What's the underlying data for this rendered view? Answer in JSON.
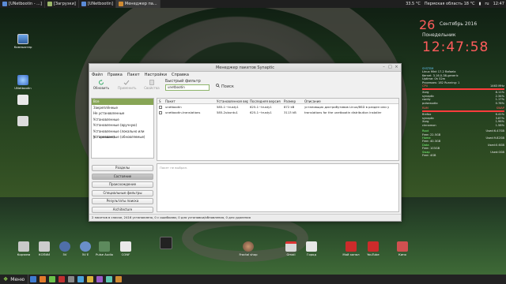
{
  "top_panel": {
    "tasks": [
      {
        "label": "[UNetbootin - ...]",
        "color": "#5b8bd6",
        "active": false
      },
      {
        "label": "[Загрузки]",
        "color": "#9cb86a",
        "active": false
      },
      {
        "label": "[UNetbootin]",
        "color": "#5b8bd6",
        "active": false
      },
      {
        "label": "Менеджер па...",
        "color": "#cf8b32",
        "active": true
      }
    ],
    "tray": {
      "temp": "33.5 °C",
      "weather": "Пермская область 18 °C",
      "battery": "▮",
      "lang": "ru",
      "time": "12:47"
    }
  },
  "clock": {
    "day": "26",
    "date": "Сентябрь 2016",
    "weekday": "Понедельник",
    "time": "12:47:58"
  },
  "conky": {
    "system_label": "SYSTEM",
    "lines": [
      "Linux Mint 17.2 Rafaela",
      "Kernel: 3.16.0-38-generic",
      "Uptime: 0h 52m",
      "Processes: 182  Running: 1"
    ],
    "cpu_label": "CPU",
    "cpu_freq": "1463 MHz",
    "ram_label": "RAM",
    "swap_label": "SWAP",
    "top_procs": [
      {
        "name": "Xorg",
        "val": "8.11%"
      },
      {
        "name": "synaptic",
        "val": "2.34%"
      },
      {
        "name": "conky",
        "val": "1.17%"
      },
      {
        "name": "pulseaudio",
        "val": "0.78%"
      }
    ],
    "mem_procs": [
      {
        "name": "firefox",
        "val": "6.41%"
      },
      {
        "name": "synaptic",
        "val": "3.87%"
      },
      {
        "name": "Xorg",
        "val": "1.96%"
      },
      {
        "name": "cinnamon",
        "val": "1.58%"
      }
    ],
    "disks": [
      {
        "name": "Root",
        "used": "Used:6.47GB",
        "free": "Free: 22.5GB"
      },
      {
        "name": "Home",
        "used": "Used:9.82GB",
        "free": "Free: 40.3GB"
      },
      {
        "name": "Data",
        "used": "Used:0.6GB",
        "free": "Free: 103GB"
      },
      {
        "name": "Swap",
        "used": "Used:0GB",
        "free": "Free: 4GB"
      }
    ]
  },
  "desktop_icons": {
    "computer": "Компьютер",
    "unetbootin": "UNetbootin",
    "file": "",
    "book": ""
  },
  "window": {
    "title": "Менеджер пакетов Synaptic",
    "menu": [
      "Файл",
      "Правка",
      "Пакет",
      "Настройки",
      "Справка"
    ],
    "toolbar": {
      "reload": "Обновить",
      "apply": "Применить",
      "properties": "Свойства"
    },
    "filter_label": "Быстрый фильтр",
    "filter_value": "unetbootin",
    "search_label": "Поиск",
    "categories": [
      "Все",
      "Закреплённые",
      "Не установленные",
      "Установленные",
      "Установленные (вручную)",
      "Установленные (локально или устаревшие)",
      "Установленные (обновляемые)"
    ],
    "filter_buttons": [
      "Разделы",
      "Состояние",
      "Происхождение",
      "Специальные фильтры",
      "Результаты поиска",
      "Architecture"
    ],
    "columns": [
      "S",
      "Пакет",
      "Установленная вер.",
      "Последняя версия",
      "Размер",
      "Описание"
    ],
    "rows": [
      {
        "name": "unetbootin",
        "installed": "585-1~trusty1",
        "latest": "625-1~trusty1",
        "size": "872 kB",
        "desc": "установщик дистрибутивов Linux/BSD в раздел или устройство USB"
      },
      {
        "name": "unetbootin-translations",
        "installed": "585-2ubuntu1",
        "latest": "625-1~trusty1",
        "size": "3113 kB",
        "desc": "translations for the unetbootin distribution installer"
      }
    ],
    "desc_placeholder": "Пакет не выбран.",
    "status": "2 пакетов в списке, 2416 установлено, 0 с ошибками, 0 для установки/обновления, 0 для удаления"
  },
  "dock": [
    {
      "label": "Корзина",
      "color": "#c9c9c9"
    },
    {
      "label": "КОПИИ",
      "color": "#cccccc"
    },
    {
      "label": "5V",
      "color": "#4f6fa8"
    },
    {
      "label": "5V E",
      "color": "#6a8fc9"
    },
    {
      "label": "Pulse Audio",
      "color": "#5d8a5d"
    },
    {
      "label": "CONF",
      "color": "#e8e8e8"
    },
    {
      "label": "",
      "color": "#222222"
    },
    {
      "label": "Fractal shop",
      "color": "#6b4a3a"
    },
    {
      "label": "Gmail",
      "color": "#d9d9d9"
    },
    {
      "label": "Город",
      "color": "#e6e6e6"
    },
    {
      "label": "Мой канал",
      "color": "#cc2b2b"
    },
    {
      "label": "YouTube",
      "color": "#cc2b2b"
    },
    {
      "label": "Кино",
      "color": "#d05050"
    }
  ],
  "bottom_panel": {
    "menu_label": "Меню"
  }
}
